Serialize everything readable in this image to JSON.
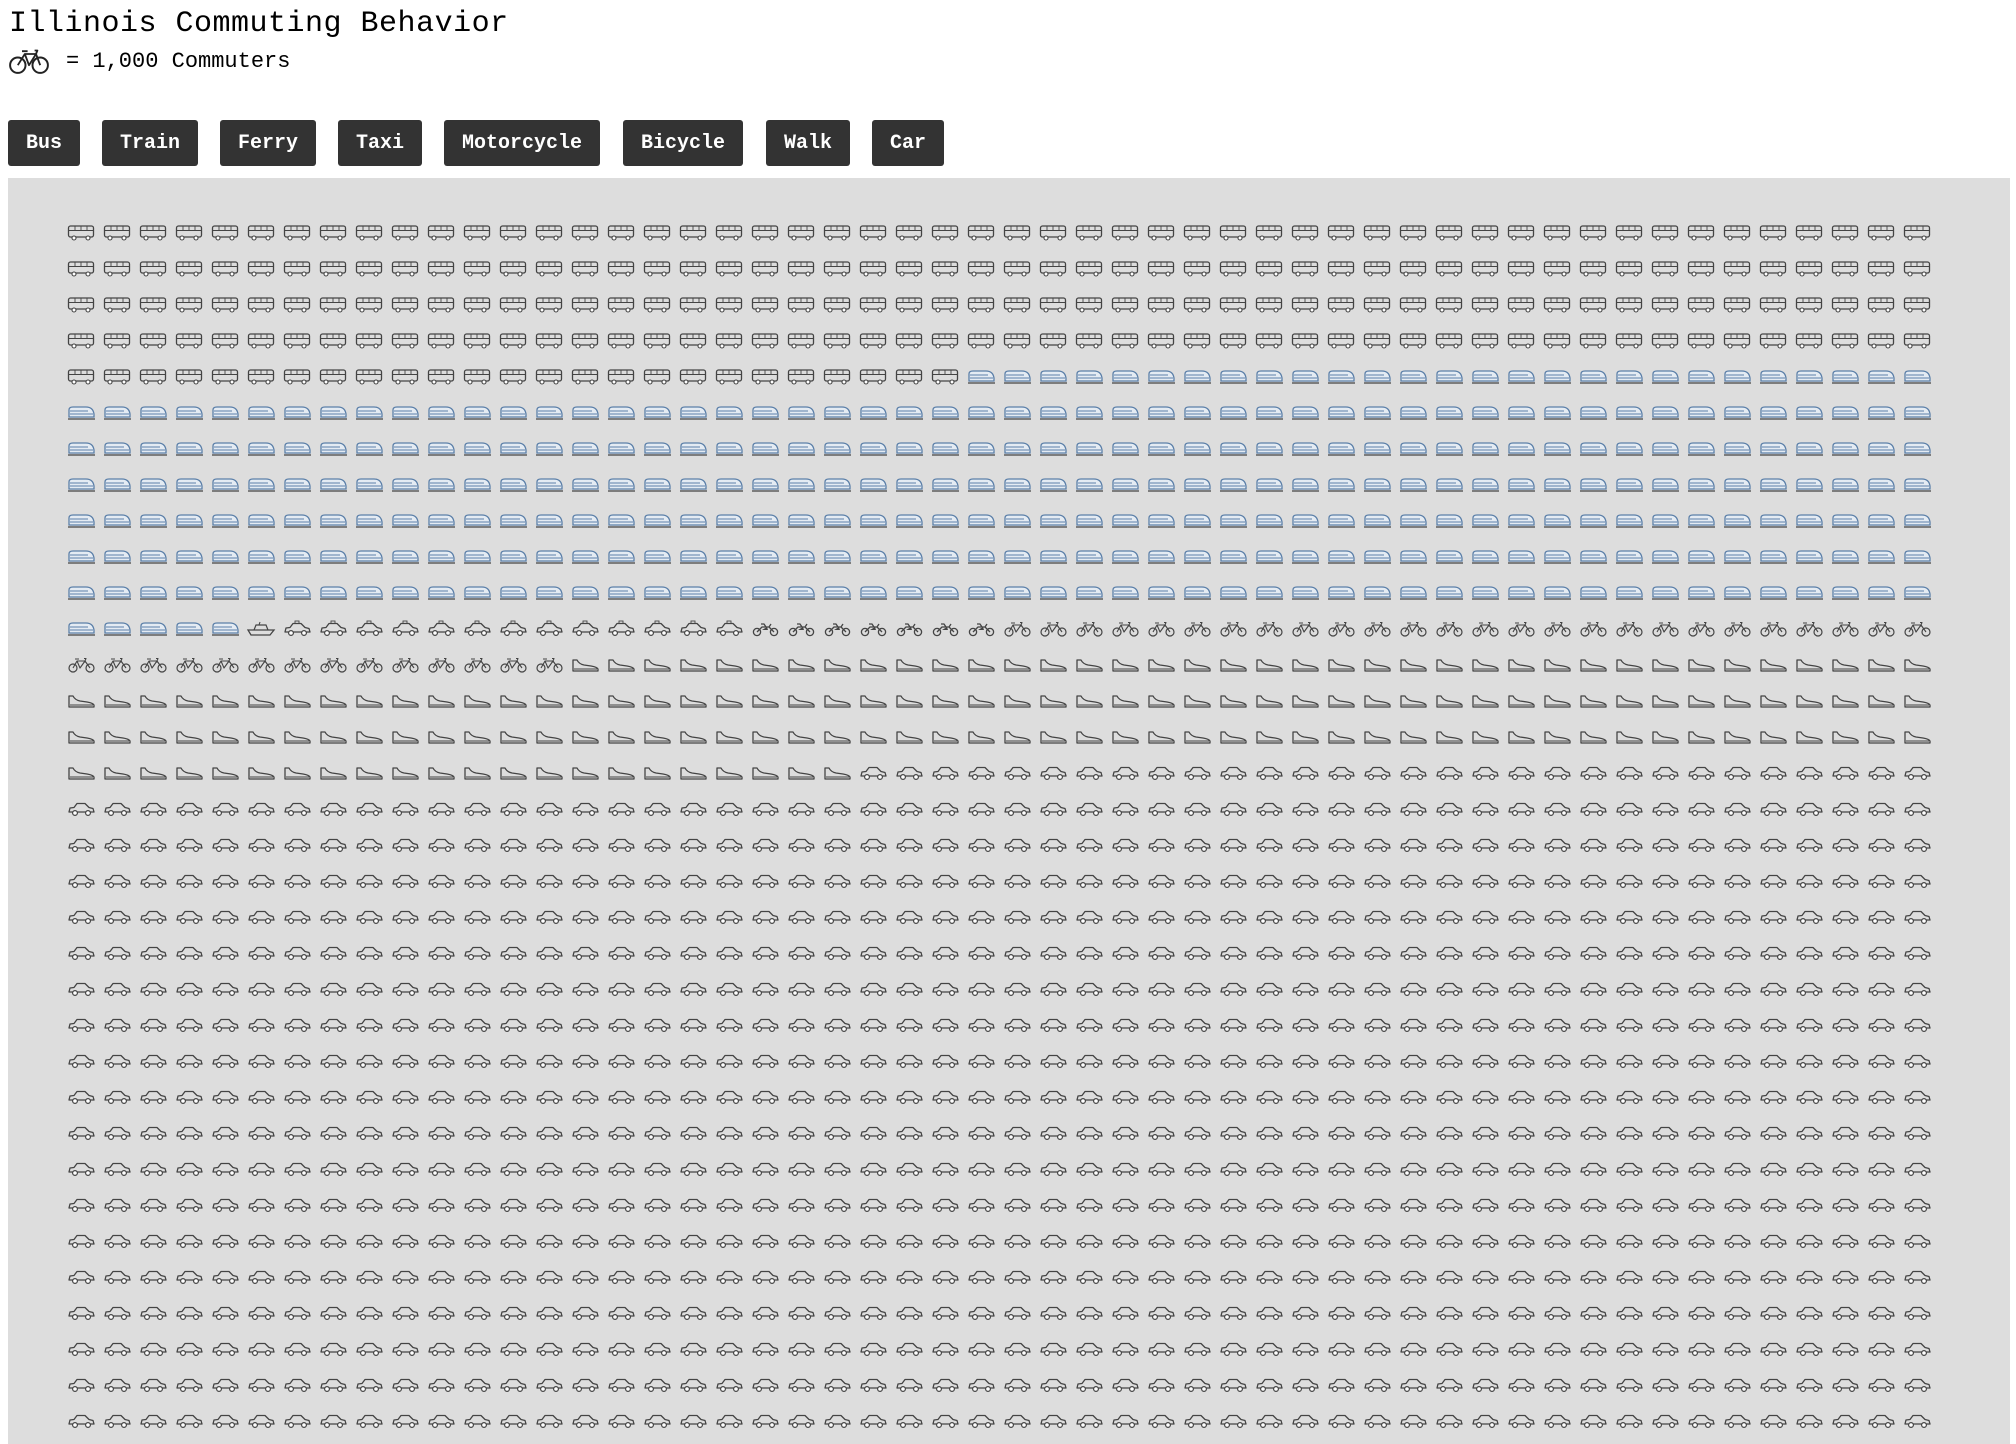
{
  "title": "Illinois Commuting Behavior",
  "legend": {
    "icon": "bicycle-icon",
    "text": "= 1,000 Commuters"
  },
  "buttons": [
    {
      "label": "Bus",
      "icon": "bus"
    },
    {
      "label": "Train",
      "icon": "train"
    },
    {
      "label": "Ferry",
      "icon": "ferry"
    },
    {
      "label": "Taxi",
      "icon": "taxi"
    },
    {
      "label": "Motorcycle",
      "icon": "motorcycle"
    },
    {
      "label": "Bicycle",
      "icon": "bicycle"
    },
    {
      "label": "Walk",
      "icon": "walk"
    },
    {
      "label": "Car",
      "icon": "car"
    }
  ],
  "colors": {
    "button_bg": "#333333",
    "button_text": "#ffffff",
    "panel_bg": "#dddddd",
    "icon_stroke": "#444444",
    "train_accent": "#5b7fa8"
  },
  "chart_data": {
    "type": "isotype",
    "title": "Illinois Commuting Behavior",
    "unit_label": "= 1,000 Commuters",
    "unit_value": 1000,
    "icons_per_row": 52,
    "categories": [
      "Bus",
      "Train",
      "Ferry",
      "Taxi",
      "Motorcycle",
      "Bicycle",
      "Walk",
      "Car"
    ],
    "values": [
      233,
      344,
      1,
      13,
      7,
      40,
      164,
      1000
    ],
    "note_visible_car_rows": "car icons continue past the bottom edge of the screenshot"
  }
}
